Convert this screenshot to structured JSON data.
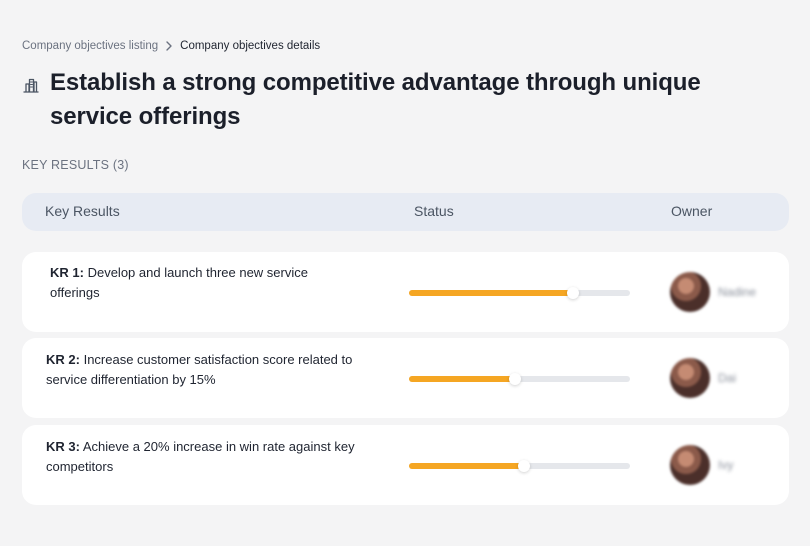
{
  "breadcrumb": {
    "items": [
      {
        "label": "Company objectives listing"
      },
      {
        "label": "Company objectives details"
      }
    ]
  },
  "page": {
    "title": "Establish a strong competitive advantage through unique service offerings",
    "title_icon": "building-chart-icon"
  },
  "key_results_section": {
    "label": "KEY RESULTS (3)"
  },
  "table": {
    "headers": {
      "key_results": "Key Results",
      "status": "Status",
      "owner": "Owner"
    },
    "rows": [
      {
        "code": "KR 1:",
        "text": "Develop and launch three new service offerings",
        "progress_percent": 74,
        "owner_name": "Nadine",
        "owner_avatar": "avatar-photo-icon"
      },
      {
        "code": "KR 2:",
        "text": "Increase customer satisfaction score related to service differentiation by 15%",
        "progress_percent": 48,
        "owner_name": "Dai",
        "owner_avatar": "avatar-photo-icon"
      },
      {
        "code": "KR 3:",
        "text": "Achieve a 20% increase in win rate against key competitors",
        "progress_percent": 52,
        "owner_name": "Ivy",
        "owner_avatar": "avatar-photo-icon"
      }
    ]
  },
  "colors": {
    "background": "#f4f4f5",
    "header_bg": "#e7ebf3",
    "row_bg": "#ffffff",
    "progress_fill": "#f5a623",
    "progress_track": "#e5e7eb",
    "text_primary": "#1f2430",
    "text_secondary": "#6b7280"
  }
}
